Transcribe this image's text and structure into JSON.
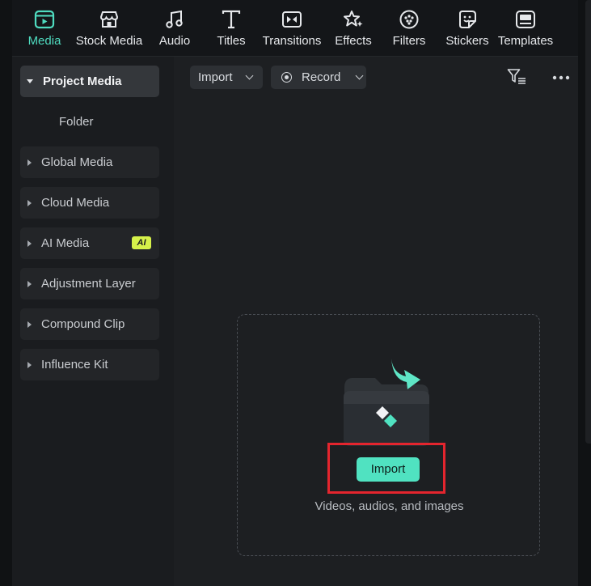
{
  "toolbar": {
    "tabs": [
      {
        "label": "Media",
        "icon": "media-icon",
        "active": true
      },
      {
        "label": "Stock Media",
        "icon": "stock-media-icon"
      },
      {
        "label": "Audio",
        "icon": "music-note-icon"
      },
      {
        "label": "Titles",
        "icon": "text-t-icon"
      },
      {
        "label": "Transitions",
        "icon": "transitions-icon"
      },
      {
        "label": "Effects",
        "icon": "sparkle-star-icon"
      },
      {
        "label": "Filters",
        "icon": "filter-circle-icon"
      },
      {
        "label": "Stickers",
        "icon": "sticker-smiley-icon"
      },
      {
        "label": "Templates",
        "icon": "templates-icon"
      }
    ]
  },
  "sidebar": {
    "project_media": "Project Media",
    "folder": "Folder",
    "items": [
      {
        "label": "Global Media"
      },
      {
        "label": "Cloud Media"
      },
      {
        "label": "AI Media",
        "badge": "AI"
      },
      {
        "label": "Adjustment Layer"
      },
      {
        "label": "Compound Clip"
      },
      {
        "label": "Influence Kit"
      }
    ]
  },
  "content": {
    "import_dropdown": "Import",
    "record_dropdown": "Record",
    "drop_zone": {
      "button": "Import",
      "caption": "Videos, audios, and images"
    }
  },
  "colors": {
    "accent": "#50e2c1",
    "highlight": "#e4252e",
    "ai_badge": "#d6f14a"
  }
}
